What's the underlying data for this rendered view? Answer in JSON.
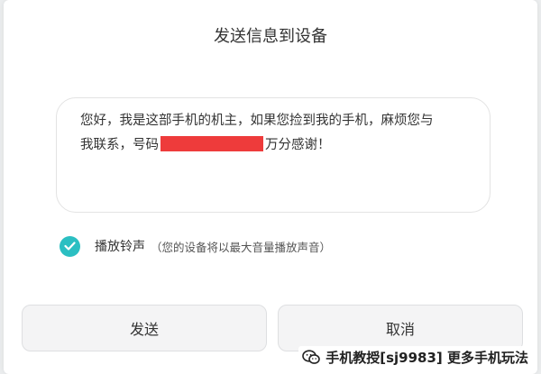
{
  "dialog": {
    "title": "发送信息到设备",
    "message": {
      "line1": "您好，我是这部手机的机主，如果您捡到我的手机，麻烦您与",
      "line2_prefix": "我联系，号码",
      "line2_suffix": "万分感谢！"
    },
    "ring": {
      "checked": true,
      "label": "播放铃声",
      "hint": "（您的设备将以最大音量播放声音）"
    },
    "buttons": {
      "send_label": "发送",
      "cancel_label": "取消"
    }
  },
  "watermark": {
    "icon": "wechat-icon",
    "text": "手机教授[sj9983] 更多手机玩法"
  },
  "colors": {
    "accent": "#2bbfc2",
    "redaction": "#ee3b3b"
  }
}
